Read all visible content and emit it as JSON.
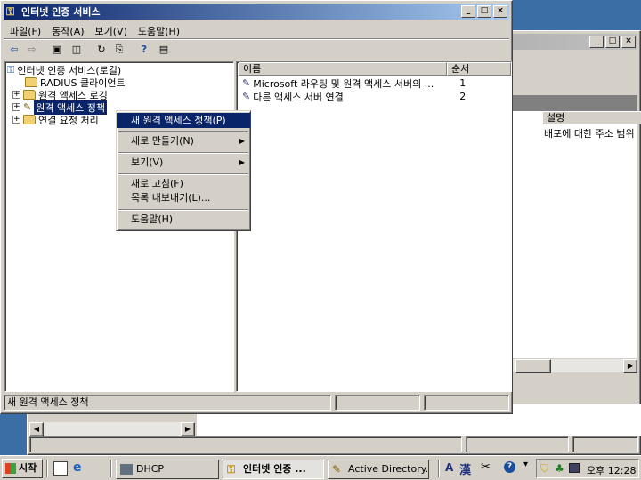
{
  "main_window": {
    "title": "인터넷 인증 서비스",
    "menu": [
      {
        "label": "파일(F)"
      },
      {
        "label": "동작(A)"
      },
      {
        "label": "보기(V)"
      },
      {
        "label": "도움말(H)"
      }
    ],
    "tree": {
      "root": "인터넷 인증 서비스(로컬)",
      "items": [
        {
          "label": "RADIUS 클라이언트",
          "expander": ""
        },
        {
          "label": "원격 액세스 로깅",
          "expander": "+"
        },
        {
          "label": "원격 액세스 정책",
          "expander": "+"
        },
        {
          "label": "연결 요청 처리",
          "expander": "+"
        }
      ]
    },
    "list": {
      "columns": [
        "이름",
        "순서"
      ],
      "rows": [
        {
          "name": "Microsoft 라우팅 및 원격 액세스 서버의 ...",
          "order": "1"
        },
        {
          "name": "다른 액세스 서버 연결",
          "order": "2"
        }
      ]
    },
    "status_text": "새 원격 액세스 정책"
  },
  "context_menu": {
    "items": [
      {
        "label": "새 원격 액세스 정책(P)"
      },
      {
        "label": "새로 만들기(N)"
      },
      {
        "label": "보기(V)"
      },
      {
        "label": "새로 고침(F)"
      },
      {
        "label": "목록 내보내기(L)..."
      },
      {
        "label": "도움말(H)"
      }
    ]
  },
  "bg_window": {
    "column": "설명",
    "desc_text": "배포에 대한 주소 범위"
  },
  "taskbar": {
    "start": "시작",
    "tasks": [
      {
        "label": "DHCP"
      },
      {
        "label": "인터넷 인증 ..."
      },
      {
        "label": "Active Directory..."
      }
    ],
    "ime_a": "A",
    "ime_han": "漢",
    "clock": "오후 12:28"
  },
  "colors": {
    "desktop": "#3a6ea5",
    "title_active": "#0a246a",
    "face": "#d4d0c8"
  }
}
